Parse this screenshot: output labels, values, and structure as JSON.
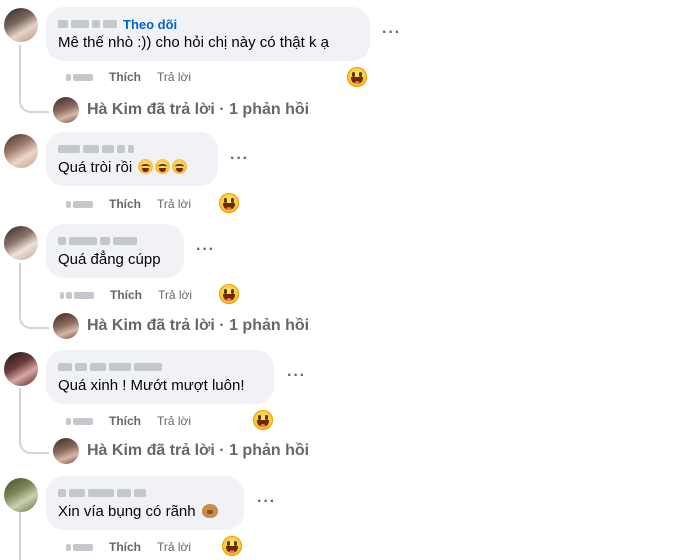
{
  "actions": {
    "like": "Thích",
    "reply": "Trả lời"
  },
  "more_label": "···",
  "comments": [
    {
      "follow": "Theo dõi",
      "text": "Mê thế nhò :)) cho hỏi chị này có thật k ạ",
      "reply_summary": "Hà Kim đã trả lời · 1 phản hồi"
    },
    {
      "text": "Quá tròi rồi"
    },
    {
      "text": "Quá đẳng cúpp",
      "reply_summary": "Hà Kim đã trả lời · 1 phản hồi"
    },
    {
      "text": "Quá xinh ! Mướt mượt luôn!",
      "reply_summary": "Hà Kim đã trả lời · 1 phản hồi"
    },
    {
      "text": "Xin vía bụng có rãnh"
    }
  ]
}
